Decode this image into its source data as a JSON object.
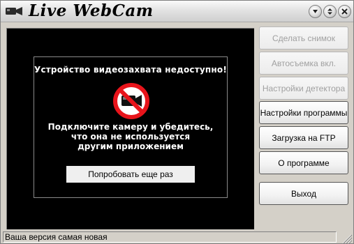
{
  "window": {
    "title": "Live WebCam",
    "title_buttons": [
      "minimize",
      "restore",
      "close"
    ]
  },
  "video": {
    "error_title": "Устройство видеозахвата недоступно!",
    "error_lines": [
      "Подключите камеру и убедитесь,",
      "что она не используется",
      "другим приложением"
    ],
    "retry_label": "Попробовать еще раз",
    "icon": "no-camera-icon"
  },
  "side_buttons": [
    {
      "label": "Сделать снимок",
      "enabled": false
    },
    {
      "label": "Автосъемка вкл.",
      "enabled": false
    },
    {
      "label": "Настройки детектора",
      "enabled": false
    },
    {
      "label": "Настройки программы",
      "enabled": true
    },
    {
      "label": "Загрузка на FTP",
      "enabled": true
    },
    {
      "label": "О программе",
      "enabled": true
    },
    {
      "label": "Выход",
      "enabled": true
    }
  ],
  "status": {
    "text": "Ваша версия самая новая"
  },
  "colors": {
    "video_bg": "#000000",
    "no_sign_red": "#e8141b",
    "window_bg": "#d4d0c8"
  }
}
